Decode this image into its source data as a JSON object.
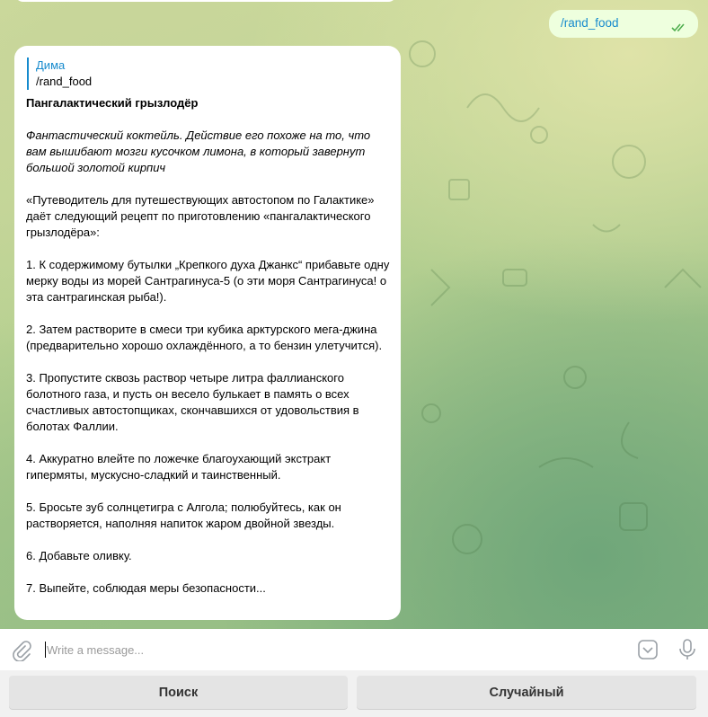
{
  "chat": {
    "outgoing": {
      "text": "/rand_food",
      "status_icon": "double-check-icon"
    },
    "incoming": {
      "reply_to": {
        "name": "Дима",
        "text": "/rand_food"
      },
      "title": "Пангалактический грызлодёр",
      "italic_intro": "Фантастический коктейль. Действие его похоже на то, что вам вышибают мозги кусочком лимона, в который завернут большой золотой кирпич",
      "intro": "«Путеводитель для путешествующих автостопом по Галактике» даёт следующий рецепт по приготовлению «пангалактического грызлодёра»:",
      "steps": [
        "1. К содержимому бутылки „Крепкого духа Джанкс“ прибавьте одну мерку воды из морей Сантрагинуса-5 (о эти моря Сантрагинуса! о эта сантрагинская рыба!).",
        "2. Затем растворите в смеси три кубика арктурского мега-джина (предварительно хорошо охлаждённого, а то бензин улетучится).",
        "3. Пропустите сквозь раствор четыре литра фаллианского болотного газа, и пусть он весело булькает в память о всех счастливых автостопщиках, скончавшихся от удовольствия в болотах Фаллии.",
        "4. Аккуратно влейте по ложечке благоухающий экстракт гипермяты, мускусно-сладкий и таинственный.",
        "5. Бросьте зуб солнцетигра с Алгола; полюбуйтесь, как он растворяется, наполняя напиток жаром двойной звезды.",
        "6. Добавьте оливку.",
        "7. Выпейте, соблюдая меры безопасности..."
      ]
    }
  },
  "composer": {
    "placeholder": "Write a message...",
    "attach_icon": "paperclip-icon",
    "keyboard_icon": "keyboard-toggle-icon",
    "mic_icon": "microphone-icon"
  },
  "keyboard": {
    "buttons": [
      "Поиск",
      "Случайный"
    ]
  },
  "colors": {
    "accent": "#168acd",
    "outgoing_bubble": "#eeffde",
    "incoming_bubble": "#ffffff"
  }
}
